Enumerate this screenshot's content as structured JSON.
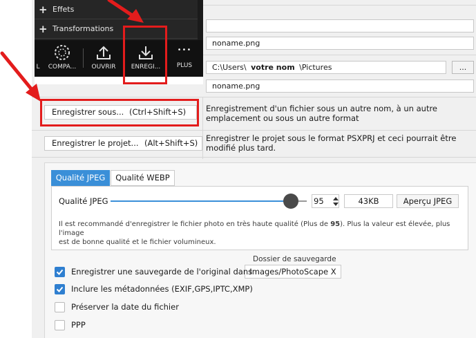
{
  "menu": {
    "items": [
      {
        "label": "Effets"
      },
      {
        "label": "Transformations"
      }
    ]
  },
  "toolbar": {
    "clip_label": "L",
    "buttons": [
      {
        "label": "COMPA..."
      },
      {
        "label": "OUVRIR"
      },
      {
        "label": "ENREGI..."
      },
      {
        "label": "PLUS"
      }
    ],
    "more_glyph": "•••"
  },
  "file": {
    "field_empty": "",
    "filename_top": "noname.png",
    "path_start": "C:\\Users\\",
    "path_user": "votre nom",
    "path_end": "\\Pictures",
    "browse_label": "...",
    "filename_bottom": "noname.png"
  },
  "actions": {
    "save_as": {
      "label": "Enregistrer sous...",
      "shortcut": "(Ctrl+Shift+S)",
      "description_line1": "Enregistrement d'un fichier sous un autre nom, à un autre",
      "description_line2": "emplacement ou sous un autre format"
    },
    "save_project": {
      "label": "Enregistrer le projet...",
      "shortcut": "(Alt+Shift+S)",
      "description_line1": "Enregistrer le projet sous le format PSXPRJ et ceci pourrait être",
      "description_line2": "modifié plus tard."
    }
  },
  "quality": {
    "tabs": [
      {
        "label": "Qualité JPEG",
        "active": true
      },
      {
        "label": "Qualité WEBP",
        "active": false
      }
    ],
    "label": "Qualité JPEG",
    "value": 95,
    "value_display": "95",
    "slider_fraction": 0.95,
    "size": "43KB",
    "preview_label": "Aperçu JPEG",
    "info_line1": "Il est recommandé d'enregistrer le fichier photo en très haute qualité (Plus de ",
    "info_bold": "95",
    "info_line1_end": "). Plus la valeur est élevée, plus l'image",
    "info_line2": "est de bonne qualité et le fichier volumineux."
  },
  "backup": {
    "folder_caption": "Dossier de sauvegarde",
    "folder_value": "Images/PhotoScape X"
  },
  "options": [
    {
      "label": "Enregistrer une sauvegarde de l'original dans",
      "checked": true
    },
    {
      "label": "Inclure les métadonnées (EXIF,GPS,IPTC,XMP)",
      "checked": true
    },
    {
      "label": "Préserver la date du fichier",
      "checked": false
    },
    {
      "label": "PPP",
      "checked": false
    }
  ],
  "colors": {
    "accent": "#3a8fd8",
    "annotation_red": "#e31c1c",
    "dark_panel": "#262626"
  }
}
